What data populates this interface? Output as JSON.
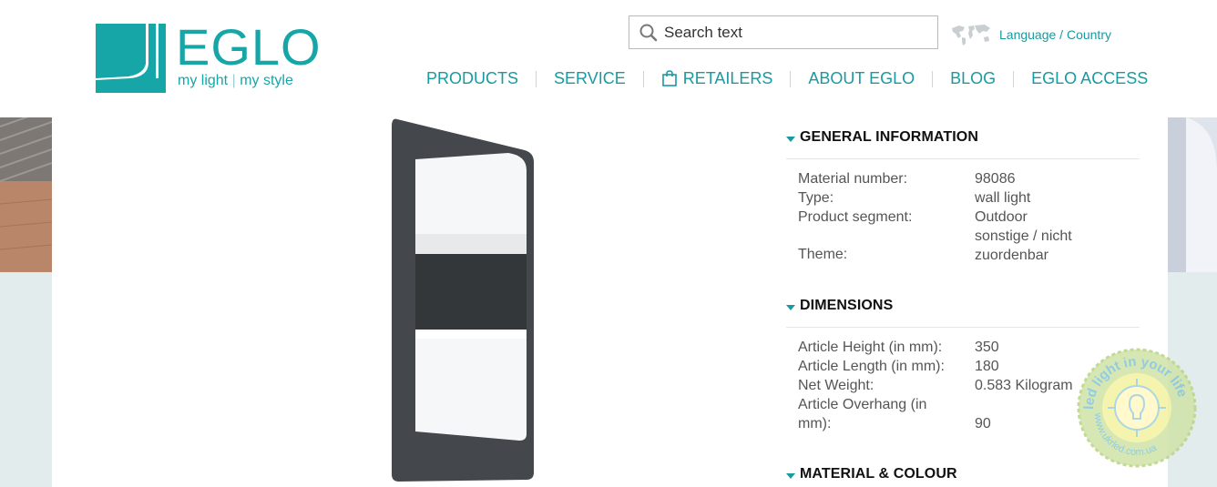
{
  "header": {
    "logo": {
      "brand": "EGLO",
      "tagline_left": "my light",
      "tagline_right": "my style"
    },
    "search": {
      "placeholder": "Search text"
    },
    "language_link": "Language / Country",
    "nav": [
      "PRODUCTS",
      "SERVICE",
      "RETAILERS",
      "ABOUT EGLO",
      "BLOG",
      "EGLO ACCESS"
    ]
  },
  "details": {
    "general": {
      "title": "GENERAL INFORMATION",
      "rows": [
        {
          "label": "Material number:",
          "value": "98086"
        },
        {
          "label": "Type:",
          "value": "wall light"
        },
        {
          "label": "Product segment:",
          "value": "Outdoor"
        },
        {
          "label": "Theme:",
          "value_line1": "sonstige / nicht",
          "value_line2": "zuordenbar"
        }
      ]
    },
    "dimensions": {
      "title": "DIMENSIONS",
      "rows": [
        {
          "label": "Article Height (in mm):",
          "value": "350"
        },
        {
          "label": "Article Length (in mm):",
          "value": "180"
        },
        {
          "label": "Net Weight:",
          "value": "0.583 Kilogram"
        },
        {
          "label_line1": "Article Overhang (in",
          "label_line2": "mm):",
          "value": "90"
        }
      ]
    },
    "material": {
      "title": "MATERIAL & COLOUR"
    }
  },
  "watermark": {
    "seal_text": "led light in your life",
    "url": "www.ukrled.com.ua"
  },
  "colors": {
    "accent": "#1a9aa0",
    "logo": "#17a6a8",
    "band": "#e3ecec"
  }
}
